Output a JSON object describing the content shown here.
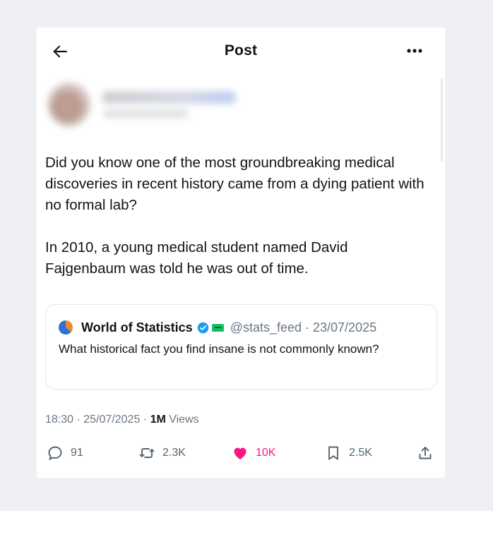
{
  "header": {
    "title": "Post",
    "back_icon": "arrow-left-icon",
    "more_icon": "more-dots-icon"
  },
  "post": {
    "paragraphs": [
      "Did you know one of the most groundbreaking medical discoveries in recent history came from a dying patient with no formal lab?",
      "In 2010, a young medical student named David Fajgenbaum was told he was out of time."
    ],
    "timestamp": "18:30 · 25/07/2025 · ",
    "views_count": "1M",
    "views_label": " Views"
  },
  "quote": {
    "author_name": "World of Statistics",
    "handle_date": "@stats_feed · 23/07/2025",
    "text": "What historical fact you find insane is not commonly known?",
    "verified_color": "#1d9bf0"
  },
  "actions": {
    "replies": "91",
    "reposts": "2.3K",
    "likes": "10K",
    "bookmarks": "2.5K",
    "like_color": "#f91880"
  }
}
